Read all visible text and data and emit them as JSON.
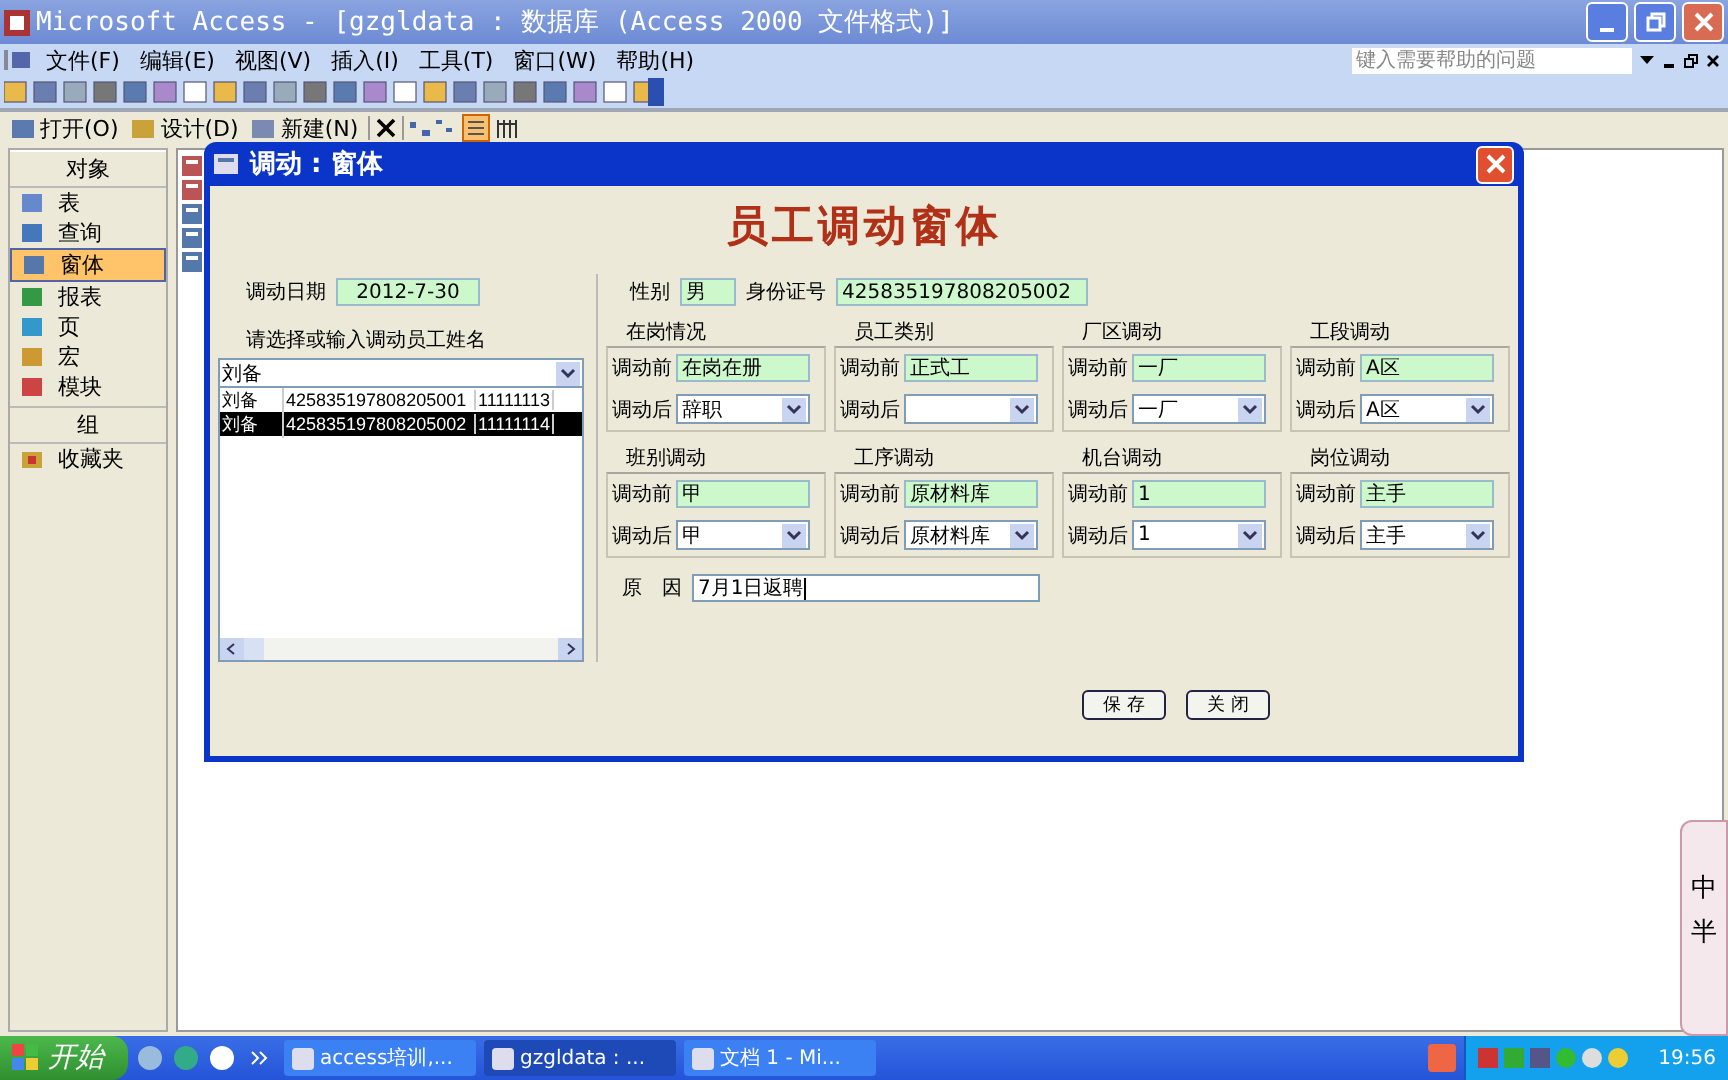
{
  "window": {
    "title": "Microsoft Access - [gzgldata : 数据库 (Access 2000 文件格式)]"
  },
  "menu": [
    "文件(F)",
    "编辑(E)",
    "视图(V)",
    "插入(I)",
    "工具(T)",
    "窗口(W)",
    "帮助(H)"
  ],
  "help_box": {
    "placeholder": "键入需要帮助的问题"
  },
  "db_toolbar": [
    "打开(O)",
    "设计(D)",
    "新建(N)"
  ],
  "objects_panel": {
    "header": "对象",
    "items": [
      {
        "label": "表",
        "selected": false
      },
      {
        "label": "查询",
        "selected": false
      },
      {
        "label": "窗体",
        "selected": true
      },
      {
        "label": "报表",
        "selected": false
      },
      {
        "label": "页",
        "selected": false
      },
      {
        "label": "宏",
        "selected": false
      },
      {
        "label": "模块",
        "selected": false
      }
    ],
    "group_header": "组",
    "groups": [
      {
        "label": "收藏夹"
      }
    ]
  },
  "form": {
    "title": "调动 : 窗体",
    "heading": "员工调动窗体",
    "date": {
      "label": "调动日期",
      "value": "2012-7-30"
    },
    "gender": {
      "label": "性别",
      "value": "男"
    },
    "id": {
      "label": "身份证号",
      "value": "425835197808205002"
    },
    "list_label": "请选择或输入调动员工姓名",
    "combo_value": "刘备",
    "rows": [
      {
        "cells": [
          "刘备",
          "425835197808205001",
          "11111113"
        ],
        "selected": false
      },
      {
        "cells": [
          "刘备",
          "425835197808205002",
          "11111114"
        ],
        "selected": true
      }
    ],
    "sections": [
      {
        "title": "在岗情况",
        "before_label": "调动前",
        "before": "在岗在册",
        "after_label": "调动后",
        "after": "辞职"
      },
      {
        "title": "员工类别",
        "before_label": "调动前",
        "before": "正式工",
        "after_label": "调动后"
      },
      {
        "title": "厂区调动",
        "before_label": "调动前",
        "before": "一厂",
        "after_label": "调动后",
        "after": "一厂"
      },
      {
        "title": "工段调动",
        "before_label": "调动前",
        "before": "A区",
        "after_label": "调动后",
        "after": "A区"
      },
      {
        "title": "班别调动",
        "before_label": "调动前",
        "before": "甲",
        "after_label": "调动后",
        "after": "甲"
      },
      {
        "title": "工序调动",
        "before_label": "调动前",
        "before": "原材料库",
        "after_label": "调动后",
        "after": "原材料库"
      },
      {
        "title": "机台调动",
        "before_label": "调动前",
        "before": "1",
        "after_label": "调动后",
        "after": "1"
      },
      {
        "title": "岗位调动",
        "before_label": "调动前",
        "before": "主手",
        "after_label": "调动后",
        "after": "主手"
      }
    ],
    "reason": {
      "label": "原　因",
      "value": "7月1日返聘"
    },
    "buttons": [
      "保 存",
      "关 闭"
    ]
  },
  "ime_bar": "中半",
  "taskbar": {
    "start": "开始",
    "tasks": [
      {
        "label": "access培训,...",
        "selected": false
      },
      {
        "label": "gzgldata : ...",
        "selected": true
      },
      {
        "label": "文档 1 - Mi...",
        "selected": false
      }
    ],
    "clock": "19:56"
  }
}
